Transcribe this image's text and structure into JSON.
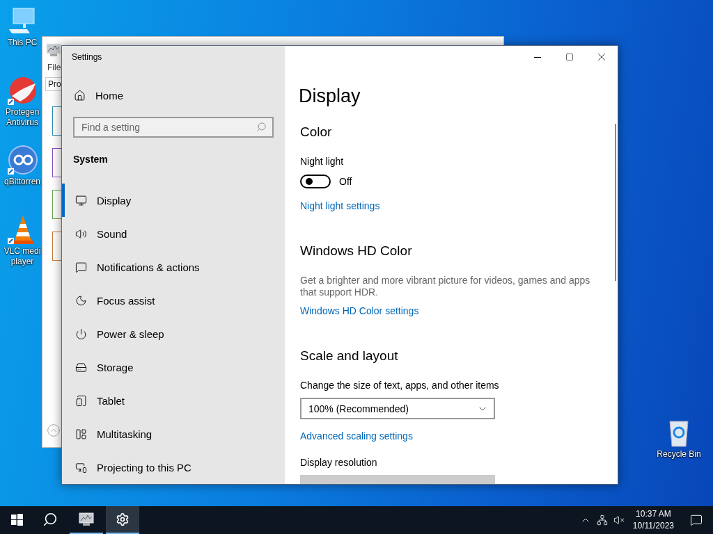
{
  "desktop_icons": [
    {
      "kind": "computer",
      "lines": [
        "This PC"
      ]
    },
    {
      "kind": "antivirus",
      "lines": [
        "Protegen",
        "Antivirus"
      ]
    },
    {
      "kind": "torrent",
      "lines": [
        "qBittorren"
      ]
    },
    {
      "kind": "cone",
      "lines": [
        "VLC medi",
        "player"
      ]
    }
  ],
  "recycle_bin": {
    "kind": "bin",
    "lines": [
      "Recycle Bin"
    ]
  },
  "background_window": {
    "menu": "File",
    "tab": "Pro"
  },
  "settings": {
    "title": "Settings",
    "home": "Home",
    "search": {
      "placeholder": "Find a setting"
    },
    "group": "System",
    "nav": [
      {
        "label": "Display",
        "kind": "display",
        "selected": true
      },
      {
        "label": "Sound",
        "kind": "sound",
        "selected": false
      },
      {
        "label": "Notifications & actions",
        "kind": "notifications",
        "selected": false
      },
      {
        "label": "Focus assist",
        "kind": "focus",
        "selected": false
      },
      {
        "label": "Power & sleep",
        "kind": "power",
        "selected": false
      },
      {
        "label": "Storage",
        "kind": "storage",
        "selected": false
      },
      {
        "label": "Tablet",
        "kind": "tablet",
        "selected": false
      },
      {
        "label": "Multitasking",
        "kind": "multitasking",
        "selected": false
      },
      {
        "label": "Projecting to this PC",
        "kind": "projecting",
        "selected": false
      }
    ]
  },
  "page": {
    "title": "Display",
    "blocks": [
      {
        "kind": "heading",
        "text": "Color"
      },
      {
        "kind": "label",
        "text": "Night light"
      },
      {
        "kind": "toggle",
        "on": false,
        "state_label": "Off"
      },
      {
        "kind": "link",
        "text": "Night light settings"
      },
      {
        "kind": "heading",
        "text": "Windows HD Color"
      },
      {
        "kind": "text",
        "text": "Get a brighter and more vibrant picture for videos, games and apps that support HDR."
      },
      {
        "kind": "link",
        "text": "Windows HD Color settings"
      },
      {
        "kind": "heading",
        "text": "Scale and layout"
      },
      {
        "kind": "label",
        "text": "Change the size of text, apps, and other items"
      },
      {
        "kind": "dropdown",
        "disabled": false,
        "value": "100% (Recommended)"
      },
      {
        "kind": "link",
        "text": "Advanced scaling settings"
      },
      {
        "kind": "label",
        "text": "Display resolution"
      },
      {
        "kind": "dropdown",
        "disabled": true
      }
    ]
  },
  "taskbar": {
    "apps": [
      {
        "kind": "monitor-app",
        "selected": false
      },
      {
        "kind": "settings",
        "selected": true
      }
    ],
    "time": "10:37 AM",
    "date": "10/11/2023"
  }
}
